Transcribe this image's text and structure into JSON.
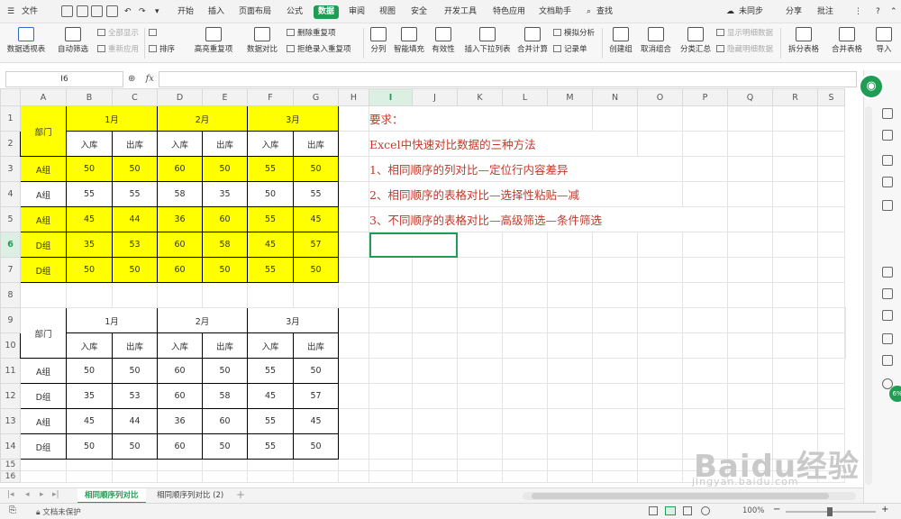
{
  "menubar": {
    "file": "文件",
    "items": [
      "开始",
      "插入",
      "页面布局",
      "公式",
      "数据",
      "审阅",
      "视图",
      "安全",
      "开发工具",
      "特色应用",
      "文档助手"
    ],
    "active_item": "数据",
    "search": "查找",
    "right": [
      "未同步",
      "分享",
      "批注"
    ]
  },
  "ribbon": {
    "pivot": "数据透视表",
    "autofilter": "自动筛选",
    "show_all": "全部显示",
    "reapply": "重新应用",
    "sort": "排序",
    "highlight_dup": "高亮重复项",
    "data_compare": "数据对比",
    "remove_dup": "删除重复项",
    "reject_dup": "拒绝录入重复项",
    "split_col": "分列",
    "smart_fill": "智能填充",
    "validity": "有效性",
    "insert_dropdown": "插入下拉列表",
    "merge_calc": "合并计算",
    "simulate": "模拟分析",
    "record": "记录单",
    "create_group": "创建组",
    "ungroup": "取消组合",
    "subtotal": "分类汇总",
    "show_detail": "显示明细数据",
    "hide_detail": "隐藏明细数据",
    "split_table": "拆分表格",
    "merge_table": "合并表格",
    "import": "导入"
  },
  "formula_bar": {
    "name_box": "I6",
    "fx": "fx",
    "value": ""
  },
  "sheet": {
    "columns": [
      "A",
      "B",
      "C",
      "D",
      "E",
      "F",
      "G",
      "H",
      "I",
      "J",
      "K",
      "L",
      "M",
      "N",
      "O",
      "P",
      "Q",
      "R",
      "S"
    ],
    "rows": [
      "1",
      "2",
      "3",
      "4",
      "5",
      "6",
      "7",
      "8",
      "9",
      "10",
      "11",
      "12",
      "13",
      "14",
      "15",
      "16"
    ],
    "selected_column": "I",
    "selected_row": "6",
    "table1": {
      "dept_header": "部门",
      "months": [
        "1月",
        "2月",
        "3月"
      ],
      "sub_headers": [
        "入库",
        "出库",
        "入库",
        "出库",
        "入库",
        "出库"
      ],
      "rows": [
        {
          "dept": "A组",
          "values": [
            "50",
            "50",
            "60",
            "50",
            "55",
            "50"
          ],
          "highlight": true
        },
        {
          "dept": "A组",
          "values": [
            "55",
            "55",
            "58",
            "35",
            "50",
            "55"
          ],
          "highlight": false
        },
        {
          "dept": "A组",
          "values": [
            "45",
            "44",
            "36",
            "60",
            "55",
            "45"
          ],
          "highlight": true
        },
        {
          "dept": "D组",
          "values": [
            "35",
            "53",
            "60",
            "58",
            "45",
            "57"
          ],
          "highlight": true
        },
        {
          "dept": "D组",
          "values": [
            "50",
            "50",
            "60",
            "50",
            "55",
            "50"
          ],
          "highlight": true
        }
      ]
    },
    "table2": {
      "dept_header": "部门",
      "months": [
        "1月",
        "2月",
        "3月"
      ],
      "sub_headers": [
        "入库",
        "出库",
        "入库",
        "出库",
        "入库",
        "出库"
      ],
      "rows": [
        {
          "dept": "A组",
          "values": [
            "50",
            "50",
            "60",
            "50",
            "55",
            "50"
          ]
        },
        {
          "dept": "D组",
          "values": [
            "35",
            "53",
            "60",
            "58",
            "45",
            "57"
          ]
        },
        {
          "dept": "A组",
          "values": [
            "45",
            "44",
            "36",
            "60",
            "55",
            "45"
          ]
        },
        {
          "dept": "D组",
          "values": [
            "50",
            "50",
            "60",
            "50",
            "55",
            "50"
          ]
        }
      ]
    },
    "requirements": [
      "要求：",
      "Excel中快速对比数据的三种方法",
      "1、相同顺序的列对比—定位行内容差异",
      "2、相同顺序的表格对比—选择性粘贴—减",
      "3、不同顺序的表格对比—高级筛选—条件筛选"
    ]
  },
  "tabs": [
    "相同顺序列对比",
    "相同顺序列对比 (2)"
  ],
  "active_tab": "相同顺序列对比",
  "status": {
    "protect": "文档未保护",
    "zoom": "100%"
  },
  "side": {
    "badge": "6%"
  },
  "watermark": {
    "main": "Baidu经验",
    "url": "jingyan.baidu.com"
  },
  "colors": {
    "accent": "#1f9d55",
    "highlight": "#ffff00",
    "requirement_text": "#c0392b"
  }
}
